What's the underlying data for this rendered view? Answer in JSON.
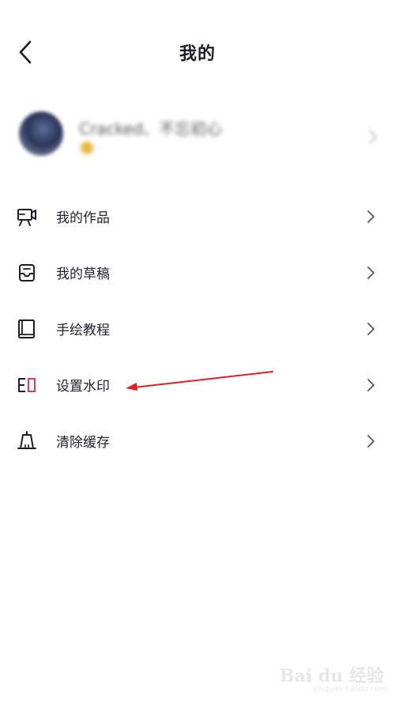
{
  "header": {
    "title": "我的",
    "back_icon": "back-arrow-icon"
  },
  "profile": {
    "username": "Cracked、不忘初心",
    "badge_text": "·"
  },
  "menu": {
    "items": [
      {
        "label": "我的作品",
        "icon": "video-camera-icon"
      },
      {
        "label": "我的草稿",
        "icon": "inbox-tray-icon"
      },
      {
        "label": "手绘教程",
        "icon": "book-icon"
      },
      {
        "label": "设置水印",
        "icon": "watermark-icon"
      },
      {
        "label": "清除缓存",
        "icon": "clear-cache-icon"
      }
    ]
  },
  "colors": {
    "text": "#222230",
    "chevron": "#555555",
    "watermark_accent": "#e8386a",
    "annotation": "#e02020"
  },
  "watermark": {
    "logo": "Bai du 经验",
    "sub": "jingyan.baidu.com"
  }
}
